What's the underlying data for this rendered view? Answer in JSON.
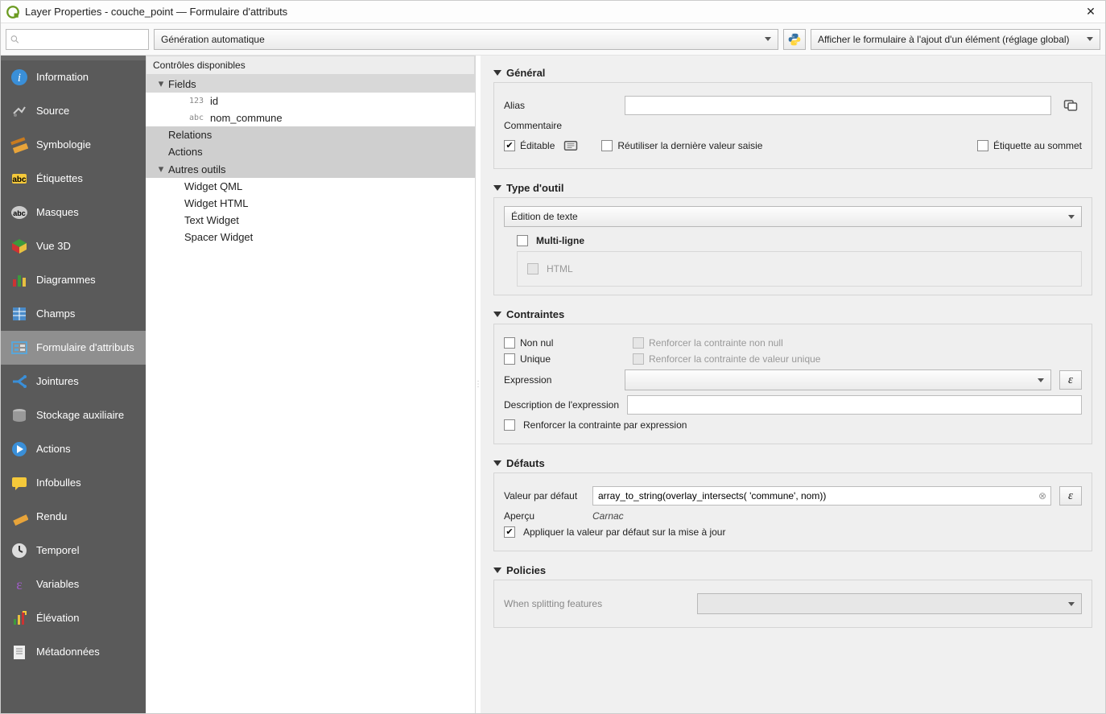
{
  "window": {
    "title": "Layer Properties - couche_point — Formulaire d'attributs"
  },
  "top": {
    "search_placeholder": "",
    "form_mode": "Génération automatique",
    "show_form_mode": "Afficher le formulaire à l'ajout d'un élément (réglage global)"
  },
  "sidebar": {
    "items": [
      {
        "label": "Information",
        "icon": "info"
      },
      {
        "label": "Source",
        "icon": "source"
      },
      {
        "label": "Symbologie",
        "icon": "symbology"
      },
      {
        "label": "Étiquettes",
        "icon": "labels"
      },
      {
        "label": "Masques",
        "icon": "masks"
      },
      {
        "label": "Vue 3D",
        "icon": "3d"
      },
      {
        "label": "Diagrammes",
        "icon": "diagrams"
      },
      {
        "label": "Champs",
        "icon": "fields"
      },
      {
        "label": "Formulaire d'attributs",
        "icon": "form",
        "selected": true
      },
      {
        "label": "Jointures",
        "icon": "joins"
      },
      {
        "label": "Stockage auxiliaire",
        "icon": "aux"
      },
      {
        "label": "Actions",
        "icon": "actions"
      },
      {
        "label": "Infobulles",
        "icon": "tips"
      },
      {
        "label": "Rendu",
        "icon": "render"
      },
      {
        "label": "Temporel",
        "icon": "temporal"
      },
      {
        "label": "Variables",
        "icon": "vars"
      },
      {
        "label": "Élévation",
        "icon": "elev"
      },
      {
        "label": "Métadonnées",
        "icon": "meta"
      }
    ]
  },
  "tree": {
    "header": "Contrôles disponibles",
    "fields_label": "Fields",
    "fields": [
      {
        "type": "123",
        "name": "id"
      },
      {
        "type": "abc",
        "name": "nom_commune"
      }
    ],
    "relations_label": "Relations",
    "actions_label": "Actions",
    "other_label": "Autres outils",
    "others": [
      "Widget QML",
      "Widget HTML",
      "Text Widget",
      "Spacer Widget"
    ]
  },
  "sections": {
    "general": {
      "title": "Général",
      "alias_label": "Alias",
      "alias_value": "",
      "comment_label": "Commentaire",
      "editable_label": "Éditable",
      "reuse_label": "Réutiliser la dernière valeur saisie",
      "label_on_top": "Étiquette au sommet"
    },
    "widget": {
      "title": "Type d'outil",
      "type": "Édition de texte",
      "multiline_label": "Multi-ligne",
      "html_label": "HTML"
    },
    "constraints": {
      "title": "Contraintes",
      "notnull_label": "Non nul",
      "enforce_notnull": "Renforcer la contrainte non null",
      "unique_label": "Unique",
      "enforce_unique": "Renforcer la contrainte de valeur unique",
      "expression_label": "Expression",
      "expression_value": "",
      "expr_desc_label": "Description de l'expression",
      "expr_desc_value": "",
      "enforce_expr": "Renforcer la contrainte par expression"
    },
    "defaults": {
      "title": "Défauts",
      "default_label": "Valeur par défaut",
      "default_value": "array_to_string(overlay_intersects( 'commune', nom))",
      "preview_label": "Aperçu",
      "preview_value": "Carnac",
      "apply_label": "Appliquer la valeur par défaut sur la mise à jour"
    },
    "policies": {
      "title": "Policies",
      "split_label": "When splitting features",
      "split_value": ""
    }
  }
}
